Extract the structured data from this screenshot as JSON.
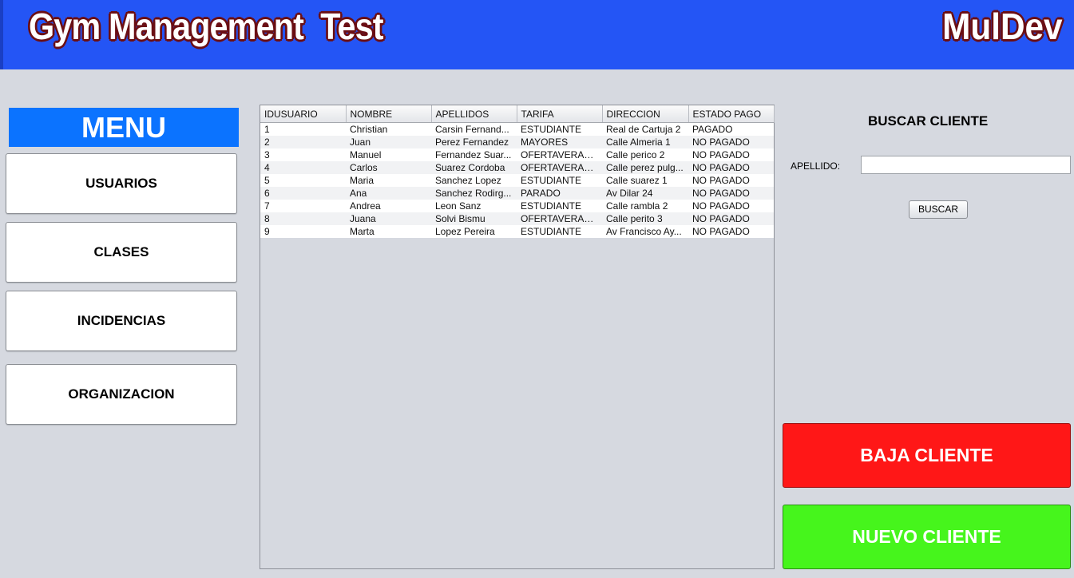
{
  "header": {
    "title": "Gym Management  Test",
    "brand": "MulDev",
    "bg_color": "#2455f5"
  },
  "menu": {
    "title": "MENU",
    "items": [
      {
        "label": "USUARIOS"
      },
      {
        "label": "CLASES"
      },
      {
        "label": "INCIDENCIAS"
      },
      {
        "label": "ORGANIZACION"
      }
    ]
  },
  "table": {
    "columns": [
      "IDUSUARIO",
      "NOMBRE",
      "APELLIDOS",
      "TARIFA",
      "DIRECCION",
      "ESTADO PAGO"
    ],
    "rows": [
      [
        "1",
        "Christian",
        "Carsin Fernand...",
        "ESTUDIANTE",
        "Real de Cartuja 2",
        "PAGADO"
      ],
      [
        "2",
        "Juan",
        "Perez Fernandez",
        "MAYORES",
        "Calle Almeria 1",
        "NO PAGADO"
      ],
      [
        "3",
        "Manuel",
        "Fernandez Suar...",
        "OFERTAVERANO",
        "Calle perico 2",
        "NO PAGADO"
      ],
      [
        "4",
        "Carlos",
        "Suarez Cordoba",
        "OFERTAVERANO",
        "Calle perez pulg...",
        "NO PAGADO"
      ],
      [
        "5",
        "Maria",
        "Sanchez Lopez",
        "ESTUDIANTE",
        "Calle suarez 1",
        "NO PAGADO"
      ],
      [
        "6",
        "Ana",
        "Sanchez Rodirg...",
        "PARADO",
        "Av Dilar 24",
        "NO PAGADO"
      ],
      [
        "7",
        "Andrea",
        "Leon Sanz",
        "ESTUDIANTE",
        "Calle rambla 2",
        "NO PAGADO"
      ],
      [
        "8",
        "Juana",
        "Solvi Bismu",
        "OFERTAVERANO",
        "Calle perito 3",
        "NO PAGADO"
      ],
      [
        "9",
        "Marta",
        "Lopez Pereira",
        "ESTUDIANTE",
        "Av  Francisco Ay...",
        "NO PAGADO"
      ]
    ]
  },
  "search": {
    "title": "BUSCAR CLIENTE",
    "apellido_label": "APELLIDO:",
    "apellido_value": "",
    "button_label": "BUSCAR"
  },
  "actions": {
    "baja_label": "BAJA CLIENTE",
    "baja_color": "#ff1717",
    "nuevo_label": "NUEVO CLIENTE",
    "nuevo_color": "#46f51c"
  }
}
